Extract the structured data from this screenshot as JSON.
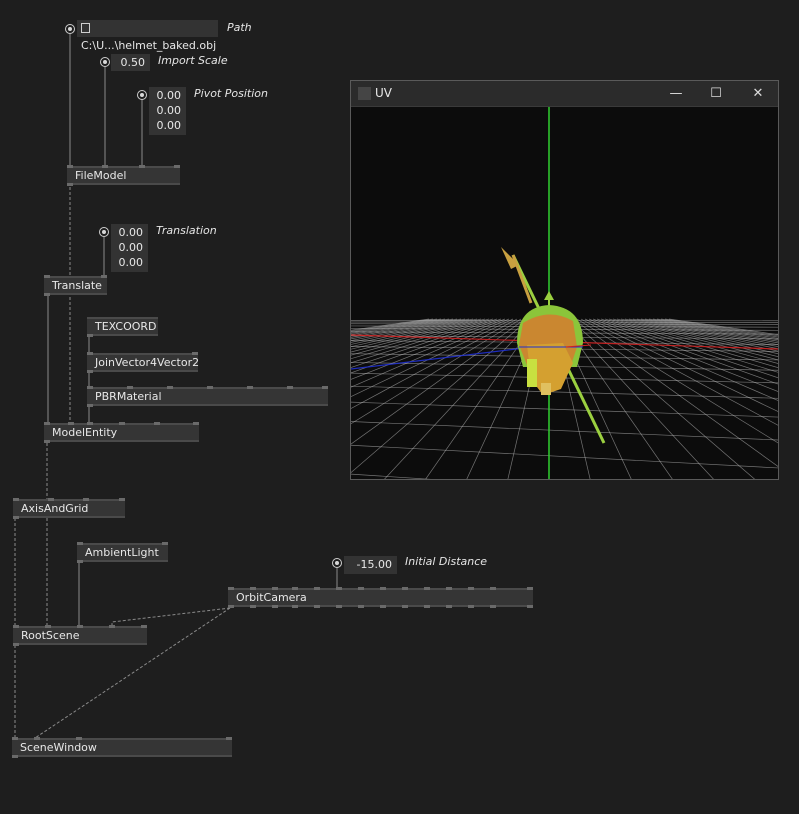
{
  "inputs": {
    "path": {
      "value": "C:\\U...\\helmet_baked.obj",
      "label": "Path"
    },
    "import_scale": {
      "value": "0.50",
      "label": "Import Scale"
    },
    "pivot_position": {
      "values": [
        "0.00",
        "0.00",
        "0.00"
      ],
      "label": "Pivot Position"
    },
    "translation": {
      "values": [
        "0.00",
        "0.00",
        "0.00"
      ],
      "label": "Translation"
    },
    "initial_distance": {
      "value": "-15.00",
      "label": "Initial Distance"
    }
  },
  "nodes": {
    "filemodel": "FileModel",
    "translate": "Translate",
    "texcoord": "TEXCOORD",
    "joinvector": "JoinVector4Vector2",
    "pbrmaterial": "PBRMaterial",
    "modelentity": "ModelEntity",
    "axisandgrid": "AxisAndGrid",
    "ambientlight": "AmbientLight",
    "orbitcamera": "OrbitCamera",
    "rootscene": "RootScene",
    "scenewindow": "SceneWindow"
  },
  "window": {
    "title": "UV",
    "minimize_glyph": "—",
    "maximize_glyph": "☐",
    "close_glyph": "✕"
  },
  "scene": {
    "grid_color": "#c8c8c8",
    "axis_x_color": "#d02020",
    "axis_y_color": "#30d030",
    "axis_z_color": "#2030d0",
    "helmet_color": "#d4a030",
    "visor_color": "#8bc53a",
    "arrow_color": "#c8a040"
  }
}
